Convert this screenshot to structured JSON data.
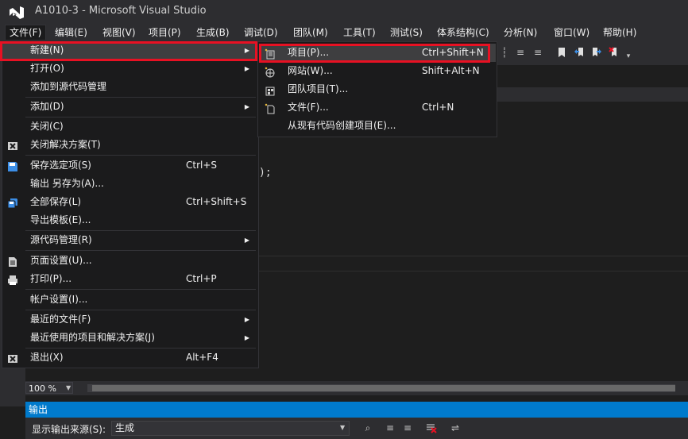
{
  "window": {
    "title": "A1010-3 - Microsoft Visual Studio"
  },
  "menubar": [
    "文件(F)",
    "编辑(E)",
    "视图(V)",
    "项目(P)",
    "生成(B)",
    "调试(D)",
    "团队(M)",
    "工具(T)",
    "测试(S)",
    "体系结构(C)",
    "分析(N)",
    "窗口(W)",
    "帮助(H)"
  ],
  "file_menu": [
    {
      "label": "新建(N)",
      "has_submenu": true,
      "highlighted": true
    },
    {
      "label": "打开(O)",
      "has_submenu": true
    },
    {
      "label": "添加到源代码管理"
    },
    {
      "label": "添加(D)",
      "has_submenu": true
    },
    {
      "label": "关闭(C)"
    },
    {
      "label": "关闭解决方案(T)",
      "icon": "close-solution-icon"
    },
    {
      "label": "保存选定项(S)",
      "shortcut": "Ctrl+S",
      "icon": "save-icon"
    },
    {
      "label": "输出 另存为(A)..."
    },
    {
      "label": "全部保存(L)",
      "shortcut": "Ctrl+Shift+S",
      "icon": "save-all-icon"
    },
    {
      "label": "导出模板(E)..."
    },
    {
      "label": "源代码管理(R)",
      "has_submenu": true
    },
    {
      "label": "页面设置(U)...",
      "icon": "page-setup-icon"
    },
    {
      "label": "打印(P)...",
      "shortcut": "Ctrl+P",
      "icon": "print-icon"
    },
    {
      "label": "帐户设置(I)..."
    },
    {
      "label": "最近的文件(F)",
      "has_submenu": true
    },
    {
      "label": "最近使用的项目和解决方案(J)",
      "has_submenu": true
    },
    {
      "label": "退出(X)",
      "shortcut": "Alt+F4",
      "icon": "exit-icon"
    }
  ],
  "new_submenu": [
    {
      "label": "项目(P)...",
      "shortcut": "Ctrl+Shift+N",
      "icon": "new-project-icon",
      "highlighted": true
    },
    {
      "label": "网站(W)...",
      "shortcut": "Shift+Alt+N",
      "icon": "new-website-icon"
    },
    {
      "label": "团队项目(T)...",
      "icon": "team-project-icon"
    },
    {
      "label": "文件(F)...",
      "shortcut": "Ctrl+N",
      "icon": "new-file-icon"
    },
    {
      "label": "从现有代码创建项目(E)..."
    }
  ],
  "editor": {
    "code_fragment": ");"
  },
  "zoom": {
    "value": "100 %"
  },
  "output_panel": {
    "title": "输出",
    "source_label": "显示输出来源(S):",
    "source_value": "生成"
  },
  "colors": {
    "highlight_border": "#e81123",
    "accent": "#007acc"
  }
}
